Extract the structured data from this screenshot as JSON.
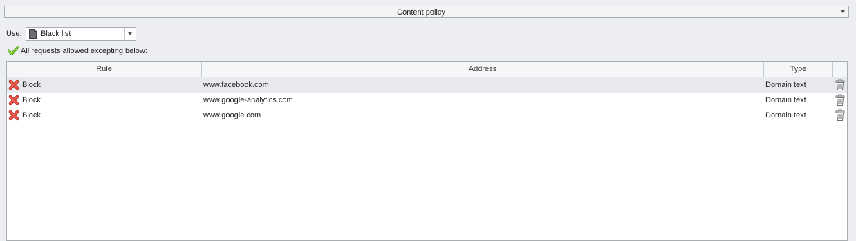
{
  "section": {
    "title": "Content policy"
  },
  "use": {
    "label": "Use:",
    "value": "Black list"
  },
  "info": {
    "text": "All requests allowed excepting below:"
  },
  "table": {
    "columns": {
      "rule": "Rule",
      "address": "Address",
      "type": "Type"
    },
    "rows": [
      {
        "rule": "Block",
        "address": "www.facebook.com",
        "type": "Domain text"
      },
      {
        "rule": "Block",
        "address": "www.google-analytics.com",
        "type": "Domain text"
      },
      {
        "rule": "Block",
        "address": "www.google.com",
        "type": "Domain text"
      }
    ]
  },
  "icons": {
    "block": "red-x-icon",
    "delete": "trash-icon",
    "allowed": "green-check-icon",
    "list": "document-icon"
  },
  "colors": {
    "block_red": "#e0392f",
    "check_green": "#6cc31f"
  }
}
